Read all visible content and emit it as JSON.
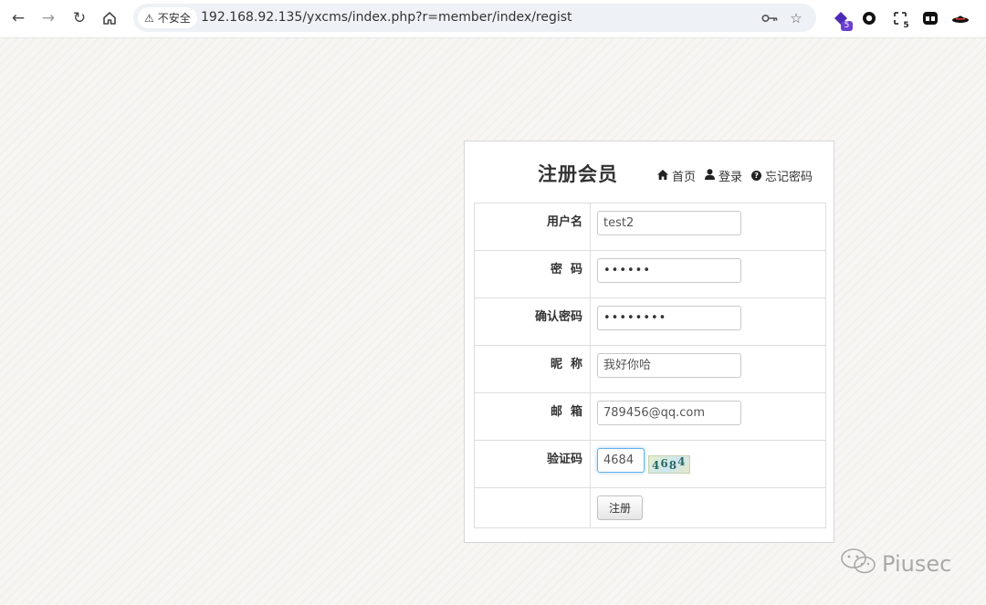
{
  "browser": {
    "security_label": "不安全",
    "url": "192.168.92.135/yxcms/index.php?r=member/index/regist",
    "extensions": [
      {
        "name": "extension-1",
        "badge": "5"
      },
      {
        "name": "extension-2",
        "badge": ""
      },
      {
        "name": "extension-3",
        "badge": "5"
      },
      {
        "name": "extension-4",
        "badge": ""
      },
      {
        "name": "extension-5",
        "badge": ""
      }
    ]
  },
  "page": {
    "title": "注册会员",
    "links": {
      "home": "首页",
      "login": "登录",
      "forgot": "忘记密码"
    },
    "form": {
      "username_label": "用户名",
      "username_value": "test2",
      "password_label": "密  码",
      "password_value": "••••••",
      "confirm_label": "确认密码",
      "confirm_value": "••••••••",
      "nickname_label": "昵  称",
      "nickname_value": "我好你哈",
      "email_label": "邮  箱",
      "email_value": "789456@qq.com",
      "captcha_label": "验证码",
      "captcha_value": "4684",
      "captcha_image_text": [
        "4",
        "6",
        "8",
        "4"
      ],
      "submit_label": "注册"
    }
  },
  "watermark": {
    "text": "Piusec"
  }
}
